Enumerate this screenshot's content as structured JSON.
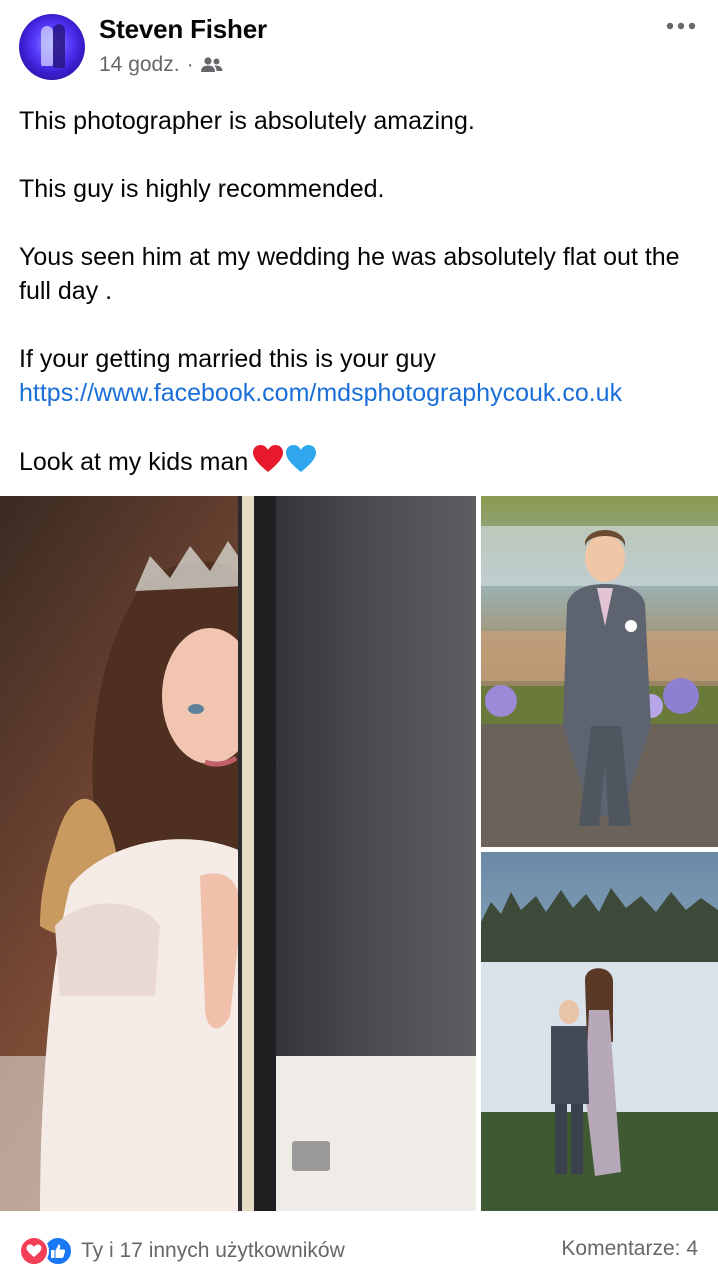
{
  "post": {
    "author": "Steven Fisher",
    "time": "14 godz.",
    "separator": "·",
    "audience_icon": "friends-icon",
    "lines": [
      "This photographer is absolutely amazing.",
      "This guy is highly recommended.",
      "Yous seen him at my wedding he was absolutely flat out the full day .",
      "If your getting married this is your guy",
      "Look at my kids man"
    ],
    "link": "https://www.facebook.com/mdsphotographycouk.co.uk",
    "emoji": "❤💙"
  },
  "photos": [
    {
      "name": "photo-girl-tiara"
    },
    {
      "name": "photo-boy-suit"
    },
    {
      "name": "photo-boy-and-woman-lake"
    }
  ],
  "footer": {
    "reactions_text": "Ty i 17 innych użytkowników",
    "comments_text": "Komentarze: 4"
  },
  "colors": {
    "link": "#1a6ed8",
    "secondary_text": "#65676b",
    "like": "#1877f2",
    "love": "#f33e58"
  }
}
